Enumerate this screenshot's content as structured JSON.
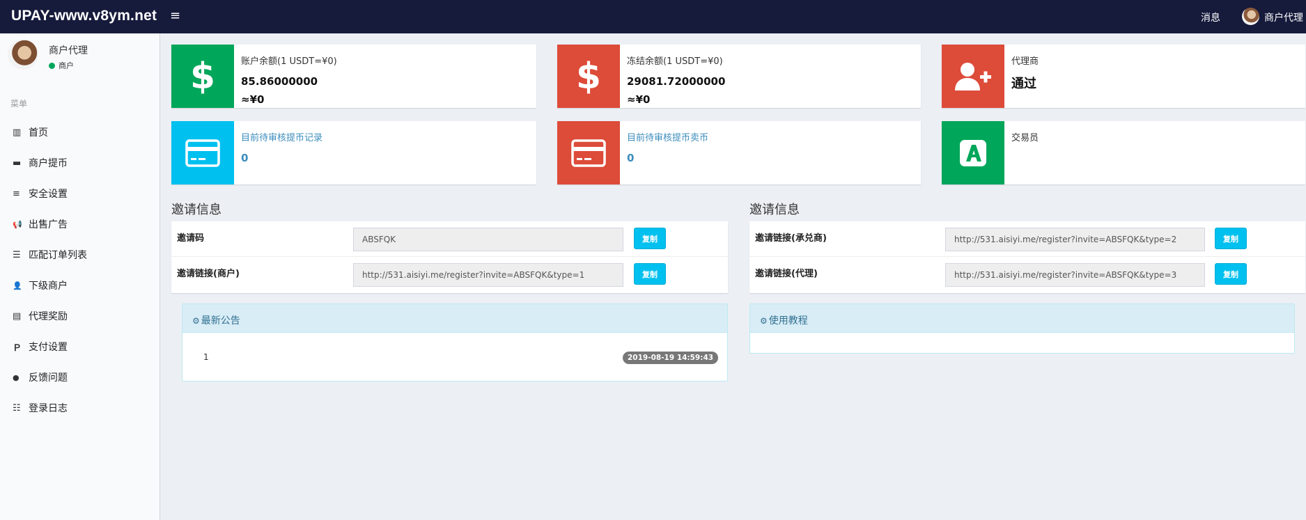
{
  "header": {
    "brand": "UPAY-www.v8ym.net",
    "menu_icon": "≡",
    "messages_label": "消息",
    "user_name": "商户代理"
  },
  "sidebar": {
    "user_name": "商户代理",
    "user_status": "商户",
    "status_color": "#00a65a",
    "menu_header": "菜单",
    "items": [
      {
        "label": "首页",
        "icon": "bar-chart-icon",
        "glyph": "▥"
      },
      {
        "label": "商户提币",
        "icon": "credit-card-icon",
        "glyph": "▬"
      },
      {
        "label": "安全设置",
        "icon": "list-icon",
        "glyph": "≡"
      },
      {
        "label": "出售广告",
        "icon": "bullhorn-icon",
        "glyph": "📢"
      },
      {
        "label": "匹配订单列表",
        "icon": "list-alt-icon",
        "glyph": "☰"
      },
      {
        "label": "下级商户",
        "icon": "user-plus-icon",
        "glyph": "👤"
      },
      {
        "label": "代理奖励",
        "icon": "server-icon",
        "glyph": "▤"
      },
      {
        "label": "支付设置",
        "icon": "paypal-icon",
        "glyph": "Ｐ"
      },
      {
        "label": "反馈问题",
        "icon": "comment-icon",
        "glyph": "●"
      },
      {
        "label": "登录日志",
        "icon": "list-ol-icon",
        "glyph": "☷"
      }
    ]
  },
  "info_boxes": {
    "balance": {
      "label": "账户余额(1 USDT=¥0)",
      "value": "85.86000000",
      "cny": "≈¥0",
      "icon": "dollar-icon",
      "color": "#00a65a"
    },
    "frozen": {
      "label": "冻结余额(1 USDT=¥0)",
      "value": "29081.72000000",
      "cny": "≈¥0",
      "icon": "dollar-icon",
      "color": "#dd4b39"
    },
    "agent": {
      "label": "代理商",
      "value": "通过",
      "icon": "user-plus-icon",
      "color": "#dd4b39"
    },
    "pending_withdraw": {
      "label": "目前待审核提币记录",
      "value": "0",
      "icon": "credit-card-icon",
      "color": "#00c0ef"
    },
    "pending_sell": {
      "label": "目前待审核提币卖币",
      "value": "0",
      "icon": "credit-card-icon",
      "color": "#dd4b39"
    },
    "trader": {
      "label": "交易员",
      "icon": "app-a-icon",
      "color": "#00a65a"
    }
  },
  "invite_left": {
    "title": "邀请信息",
    "rows": [
      {
        "label": "邀请码",
        "value": "ABSFQK",
        "button": "复制"
      },
      {
        "label": "邀请链接(商户)",
        "value": "http://531.aisiyi.me/register?invite=ABSFQK&type=1",
        "button": "复制"
      }
    ]
  },
  "invite_right": {
    "title": "邀请信息",
    "rows": [
      {
        "label": "邀请链接(承兑商)",
        "value": "http://531.aisiyi.me/register?invite=ABSFQK&type=2",
        "button": "复制"
      },
      {
        "label": "邀请链接(代理)",
        "value": "http://531.aisiyi.me/register?invite=ABSFQK&type=3",
        "button": "复制"
      }
    ]
  },
  "announcements": {
    "title": "最新公告",
    "icon": "cogs-icon",
    "items": [
      {
        "text": "1",
        "date": "2019-08-19 14:59:43"
      }
    ]
  },
  "tutorial": {
    "title": "使用教程",
    "icon": "cogs-icon"
  }
}
